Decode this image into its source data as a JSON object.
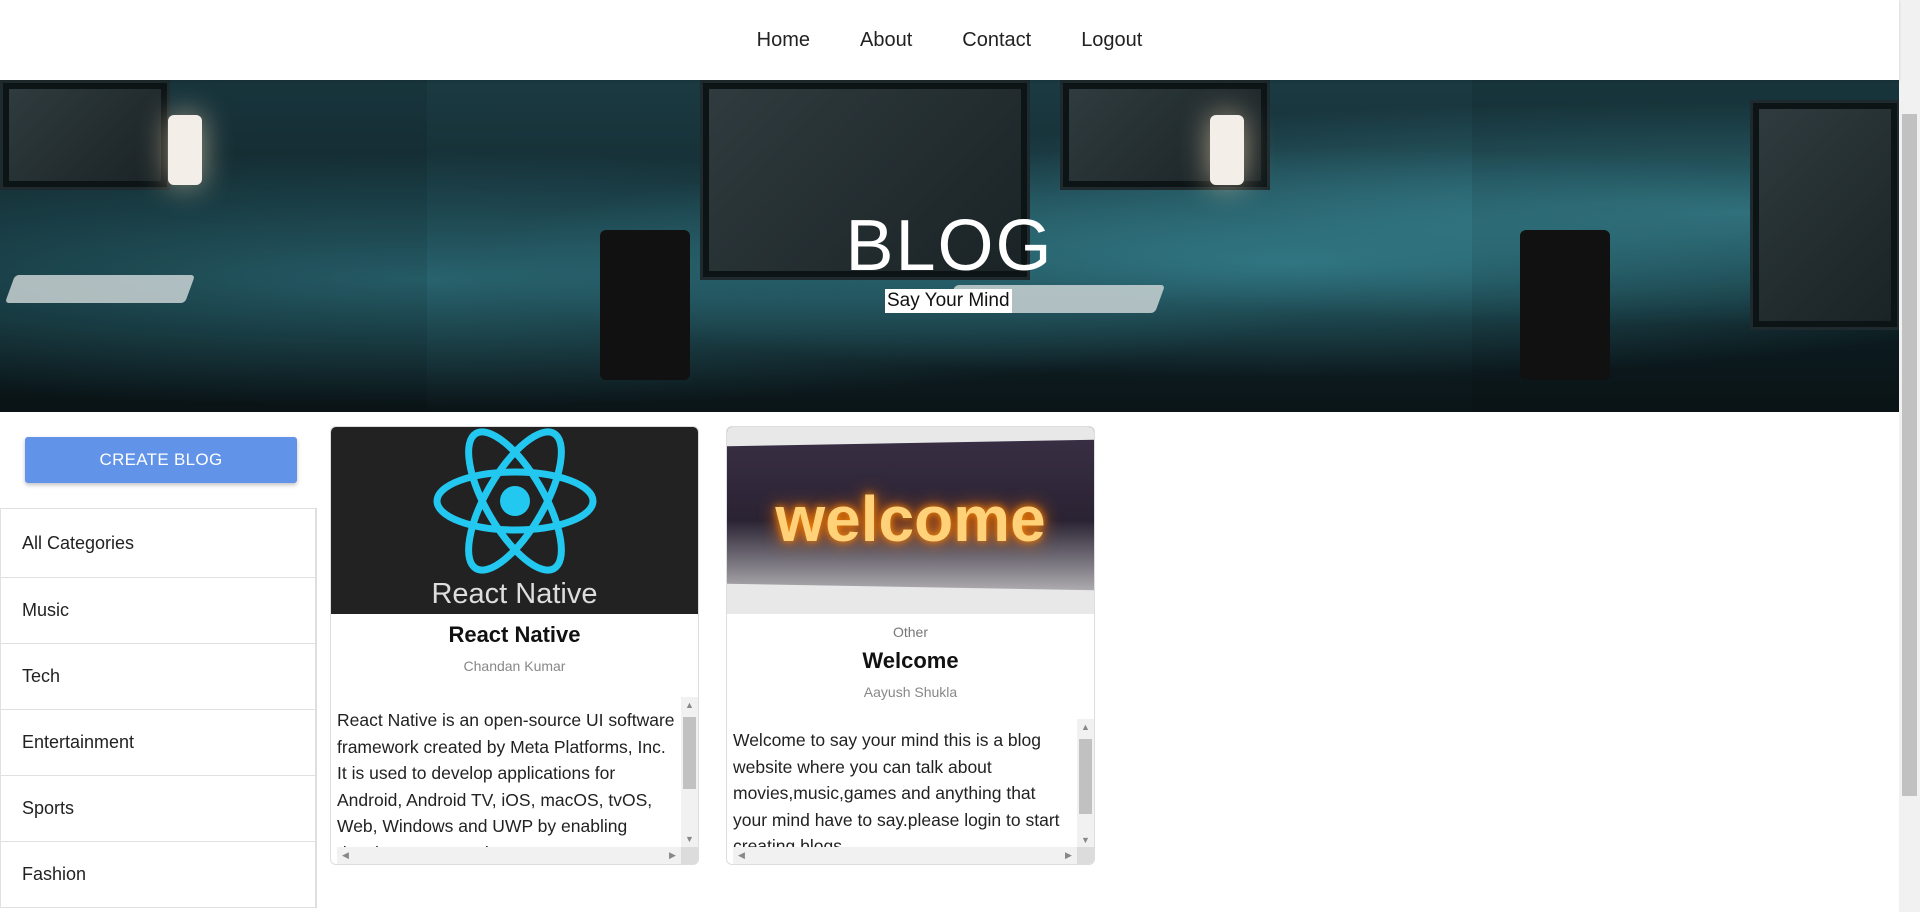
{
  "nav": {
    "items": [
      {
        "label": "Home"
      },
      {
        "label": "About"
      },
      {
        "label": "Contact"
      },
      {
        "label": "Logout"
      }
    ]
  },
  "hero": {
    "title": "BLOG",
    "subtitle": "Say Your Mind"
  },
  "sidebar": {
    "create_label": "CREATE BLOG",
    "categories": [
      {
        "label": "All Categories"
      },
      {
        "label": "Music"
      },
      {
        "label": "Tech"
      },
      {
        "label": "Entertainment"
      },
      {
        "label": "Sports"
      },
      {
        "label": "Fashion"
      }
    ]
  },
  "posts": [
    {
      "image_text": "React Native",
      "category": "",
      "title": "React Native",
      "author": "Chandan Kumar",
      "description": "React Native is an open-source UI software framework created by Meta Platforms, Inc. It is used to develop applications for Android, Android TV, iOS, macOS, tvOS, Web, Windows and UWP by enabling developers to use the React"
    },
    {
      "image_text": "welcome",
      "category": "Other",
      "title": "Welcome",
      "author": "Aayush Shukla",
      "description": "Welcome to say your mind this is a blog website where you can talk about movies,music,games and anything that your mind have to say.please login to start creating blogs."
    }
  ],
  "colors": {
    "accent": "#6193e8",
    "react_blue": "#22c8f0"
  }
}
